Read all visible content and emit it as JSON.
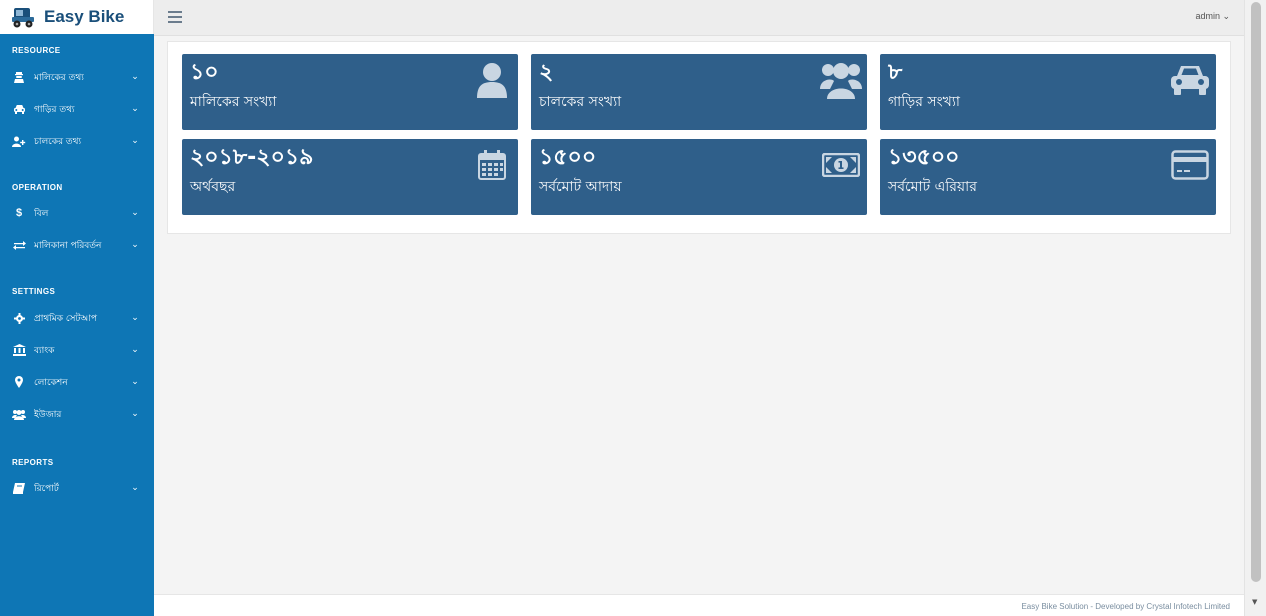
{
  "brand": {
    "name": "Easy Bike"
  },
  "header": {
    "user": "admin ⌄"
  },
  "sidebar": {
    "sections": [
      {
        "title": "RESOURCE",
        "items": [
          {
            "label": "মালিকের তথ্য",
            "icon": "user-secret-icon"
          },
          {
            "label": "গাড়ির তথ্য",
            "icon": "car-icon"
          },
          {
            "label": "চালকের তথ্য",
            "icon": "user-plus-icon"
          }
        ]
      },
      {
        "title": "OPERATION",
        "items": [
          {
            "label": "বিল",
            "icon": "dollar-icon"
          },
          {
            "label": "মালিকানা পরিবর্তন",
            "icon": "exchange-icon"
          }
        ]
      },
      {
        "title": "SETTINGS",
        "items": [
          {
            "label": "প্রাথমিক সেটআপ",
            "icon": "gear-icon"
          },
          {
            "label": "ব্যাংক",
            "icon": "bank-icon"
          },
          {
            "label": "লোকেশন",
            "icon": "map-marker-icon"
          },
          {
            "label": "ইউজার",
            "icon": "users-icon"
          }
        ]
      },
      {
        "title": "REPORTS",
        "items": [
          {
            "label": "রিপোর্ট",
            "icon": "book-icon"
          }
        ]
      }
    ]
  },
  "stats": [
    {
      "value": "১০",
      "label": "মালিকের সংখ্যা",
      "icon": "user-icon"
    },
    {
      "value": "২",
      "label": "চালকের সংখ্যা",
      "icon": "users-icon"
    },
    {
      "value": "৮",
      "label": "গাড়ির সংখ্যা",
      "icon": "car-icon"
    },
    {
      "value": "২০১৮-২০১৯",
      "label": "অর্থবছর",
      "icon": "calendar-icon"
    },
    {
      "value": "১৫০০",
      "label": "সর্বমোট আদায়",
      "icon": "money-icon"
    },
    {
      "value": "১৩৫০০",
      "label": "সর্বমোট এরিয়ার",
      "icon": "credit-card-icon"
    }
  ],
  "footer": {
    "text": "Easy Bike Solution - Developed by Crystal Infotech Limited"
  },
  "colors": {
    "sidebar": "#0e76b5",
    "tile": "#2f5f8a",
    "icon": "#c9d6e2"
  }
}
